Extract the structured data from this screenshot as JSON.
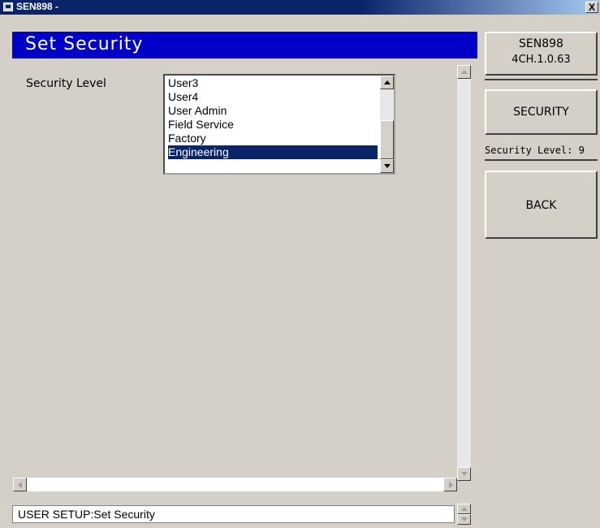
{
  "window": {
    "title": "SEN898 -",
    "close_label": "X"
  },
  "header": {
    "title": "Set Security"
  },
  "main": {
    "security_label": "Security Level",
    "security_list": {
      "items": [
        "User3",
        "User4",
        "User Admin",
        "Field Service",
        "Factory",
        "Engineering"
      ],
      "selected": "Engineering"
    }
  },
  "sidebar": {
    "version_line1": "SEN898",
    "version_line2": "4CH.1.0.63",
    "security_button": "SECURITY",
    "security_level_text": "Security Level: 9",
    "back_button": "BACK"
  },
  "status_bar": {
    "text": "USER SETUP:Set Security"
  },
  "colors": {
    "title_bar": "#0a246a",
    "header_bar": "#0000c8",
    "panel": "#d4d0c8",
    "selection": "#0a246a"
  }
}
